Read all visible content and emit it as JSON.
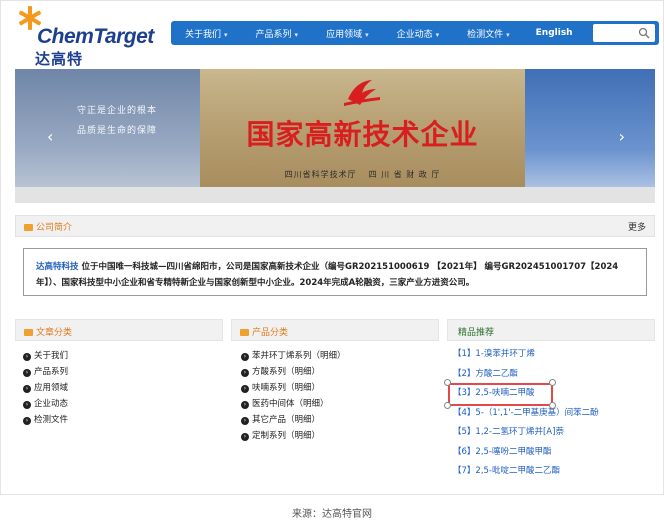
{
  "header": {
    "logo_en": "ChemTarget",
    "logo_cn": "达高特",
    "nav": [
      {
        "label": "关于我们",
        "caret": "▾"
      },
      {
        "label": "产品系列",
        "caret": "▾"
      },
      {
        "label": "应用领域",
        "caret": "▾"
      },
      {
        "label": "企业动态",
        "caret": "▾"
      },
      {
        "label": "检测文件",
        "caret": "▾"
      },
      {
        "label": "English",
        "caret": ""
      }
    ],
    "search": {
      "placeholder": "",
      "icon": "search-icon"
    }
  },
  "banner": {
    "slogan_1": "守正是企业的根本",
    "slogan_2": "品质是生命的保障",
    "plaque_title": "国家高新技术企业",
    "plaque_footer_1": "四川省科学技术厅",
    "plaque_footer_2": "四 川 省 财 政 厅",
    "prev_icon": "‹",
    "next_icon": "›"
  },
  "intro": {
    "title": "公司简介",
    "more": "更多",
    "company_link": "达高特科技",
    "text": " 位于中国唯一科技城—四川省绵阳市，公司是国家高新技术企业（编号GR202151000619 【2021年】 编号GR202451001707【2024年】）、国家科技型中小企业和省专精特新企业与国家创新型中小企业。2024年完成A轮融资，三家产业方进资公司。"
  },
  "articles": {
    "title": "文章分类",
    "items": [
      "关于我们",
      "产品系列",
      "应用领域",
      "企业动态",
      "检测文件"
    ]
  },
  "products": {
    "title": "产品分类",
    "items": [
      "苯并环丁烯系列（明细）",
      "方酸系列（明细）",
      "呋喃系列（明细）",
      "医药中间体（明细）",
      "其它产品（明细）",
      "定制系列（明细）"
    ]
  },
  "recommend": {
    "title": "精品推荐",
    "items": [
      "【1】1-溴苯并环丁烯",
      "【2】方酸二乙酯",
      "【3】2,5-呋喃二甲酸",
      "【4】5-（1',1'-二甲基庚基）间苯二酚",
      "【5】1,2-二氢环丁烯并[A]萘",
      "【6】2,5-噻吩二甲酸甲酯",
      "【7】2,5-吡啶二甲酸二乙酯"
    ]
  },
  "caption": "来源：达高特官网",
  "colors": {
    "nav": "#1f72c8",
    "accent": "#e0791c",
    "link": "#1f5fbf",
    "highlight": "#e24a4a"
  }
}
